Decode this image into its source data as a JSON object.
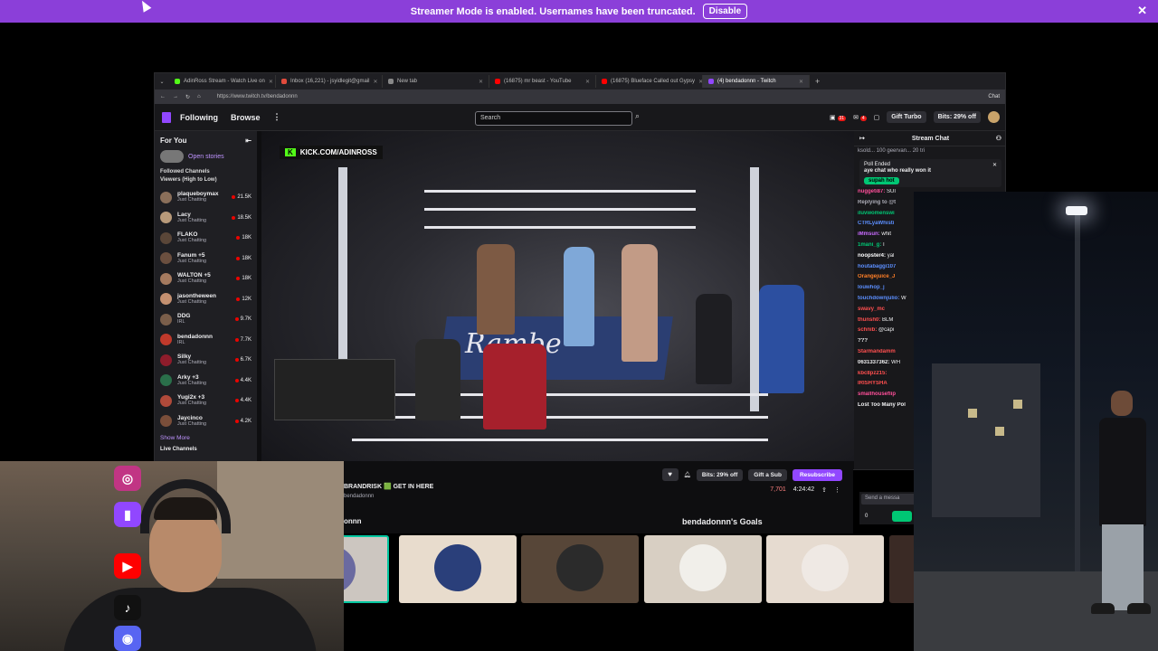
{
  "banner": {
    "text": "Streamer Mode is enabled. Usernames have been truncated.",
    "disable_label": "Disable",
    "close": "✕"
  },
  "browser": {
    "tabs": [
      {
        "label": "AdinRoss Stream - Watch Live on",
        "color": "#53fc18"
      },
      {
        "label": "Inbox (16,221) - jsyidlegit@gmail",
        "color": "#e14b3c"
      },
      {
        "label": "New tab",
        "color": "#888888"
      },
      {
        "label": "(16875) mr beast - YouTube",
        "color": "#ff0000"
      },
      {
        "label": "(16875) Blueface Called out Gypsy",
        "color": "#ff0000"
      },
      {
        "label": "(4) bendadonnn - Twitch",
        "color": "#9147ff"
      }
    ],
    "new_tab": "+",
    "url": "https://www.twitch.tv/bendadonnn",
    "chat_chip": "Chat"
  },
  "twitch_nav": {
    "following": "Following",
    "browse": "Browse",
    "more": "⋮",
    "search_placeholder": "Search",
    "notif_count": "31",
    "inbox_count": "4",
    "gift_turbo": "Gift Turbo",
    "bits": "Bits: 29% off"
  },
  "sidebar": {
    "title": "For You",
    "collapse": "⇤",
    "stories": "Open stories",
    "followed_title": "Followed Channels",
    "sort": "Viewers (High to Low)",
    "channels": [
      {
        "name": "plaqueboymax",
        "category": "Just Chatting",
        "viewers": "21.5K"
      },
      {
        "name": "Lacy",
        "category": "Just Chatting",
        "viewers": "18.5K"
      },
      {
        "name": "FLAKO",
        "category": "Just Chatting",
        "viewers": "18K"
      },
      {
        "name": "Fanum +5",
        "category": "Just Chatting",
        "viewers": "18K"
      },
      {
        "name": "WALTON +5",
        "category": "Just Chatting",
        "viewers": "18K"
      },
      {
        "name": "jasontheween",
        "category": "Just Chatting",
        "viewers": "12K"
      },
      {
        "name": "DDG",
        "category": "IRL",
        "viewers": "9.7K"
      },
      {
        "name": "bendadonnn",
        "category": "IRL",
        "viewers": "7.7K"
      },
      {
        "name": "Silky",
        "category": "Just Chatting",
        "viewers": "6.7K"
      },
      {
        "name": "Arky +3",
        "category": "Just Chatting",
        "viewers": "4.4K"
      },
      {
        "name": "Yugi2x +3",
        "category": "Just Chatting",
        "viewers": "4.4K"
      },
      {
        "name": "Jaycinco",
        "category": "Just Chatting",
        "viewers": "4.2K"
      }
    ],
    "show_more": "Show More",
    "live_channels": "Live Channels"
  },
  "video": {
    "overlay": "KICK.COM/ADINROSS",
    "mat_text": "Rambe"
  },
  "chat": {
    "title": "Stream Chat",
    "pinned": "ksold... 100 geervan... 20 tri",
    "poll_status": "Poll Ended",
    "poll_question": "aye chat who really won it",
    "poll_answer": "supah hot",
    "messages": [
      {
        "user": "nuggeti87:",
        "text": "SUI",
        "color": "#ff4f9a"
      },
      {
        "user": "Replying to @t",
        "text": "",
        "color": "#adadb8"
      },
      {
        "user": "iluvwomenswi",
        "text": "",
        "color": "#00c774"
      },
      {
        "user": "CTRLyaWhisti",
        "text": "",
        "color": "#5c8fff"
      },
      {
        "user": "iMmsun:",
        "text": "whit",
        "color": "#c96bff"
      },
      {
        "user": "1mani_g:",
        "text": "I",
        "color": "#00c774"
      },
      {
        "user": "noopster4:",
        "text": "yal",
        "color": "#ffffff"
      },
      {
        "user": "houtabaggi107",
        "text": "",
        "color": "#5c8fff"
      },
      {
        "user": "Orangejuice_J",
        "text": "",
        "color": "#ff7f27"
      },
      {
        "user": "louwhop_j",
        "text": "",
        "color": "#5c8fff"
      },
      {
        "user": "touchdownjulio:",
        "text": "W",
        "color": "#5c8fff"
      },
      {
        "user": "swavy_mc",
        "text": "",
        "color": "#ff4f4f"
      },
      {
        "user": "thunsh0:",
        "text": "BLM",
        "color": "#ff4f4f"
      },
      {
        "user": "schnib:",
        "text": "@capi",
        "color": "#ff4f4f"
      },
      {
        "user": "???",
        "text": "",
        "color": "#efeff1"
      },
      {
        "user": "Starmandamm",
        "text": "",
        "color": "#ff4f4f"
      },
      {
        "user": "0631337362:",
        "text": "WH",
        "color": "#efeff1"
      },
      {
        "user": "kbc8pz215:",
        "text": "",
        "color": "#ff4f4f"
      },
      {
        "user": "IRISHYSHA",
        "text": "",
        "color": "#ff4f4f"
      },
      {
        "user": "smallhouseflip",
        "text": "",
        "color": "#ff4f9a"
      },
      {
        "user": "Lost Too Many Pol",
        "text": "",
        "color": "#efeff1"
      }
    ],
    "send_placeholder": "Send a messa",
    "points": "0"
  },
  "stream_info": {
    "title": "BRANDRISK 🟩 GET IN HERE",
    "subtitle": "bendadonnn",
    "username": "onnn",
    "goals": "bendadonnn's Goals",
    "bits": "Bits: 29% off",
    "gift_sub": "Gift a Sub",
    "resubscribe": "Resubscribe",
    "viewers": "7,701",
    "uptime": "4:24:42"
  },
  "thumbnails": [
    {
      "bg": "#ccc6c0",
      "circ": "#6a6aa0"
    },
    {
      "bg": "#e8dccd",
      "circ": "#2a3f7a"
    },
    {
      "bg": "#574638",
      "circ": "#2b2b2b"
    },
    {
      "bg": "#d8cfc3",
      "circ": "#f1efea"
    },
    {
      "bg": "#e6dbd0",
      "circ": "#efe9e4"
    },
    {
      "bg": "#3a2a25",
      "circ": "#5a3e35"
    }
  ],
  "socials": [
    {
      "icon": "instagram-icon",
      "glyph": "◎",
      "color": "#c13584"
    },
    {
      "icon": "twitch-icon",
      "glyph": "▮",
      "color": "#9147ff"
    },
    {
      "icon": "youtube-icon",
      "glyph": "▶",
      "color": "#ff0000"
    },
    {
      "icon": "tiktok-icon",
      "glyph": "♪",
      "color": "#111111"
    },
    {
      "icon": "discord-icon",
      "glyph": "◉",
      "color": "#5865f2"
    }
  ]
}
